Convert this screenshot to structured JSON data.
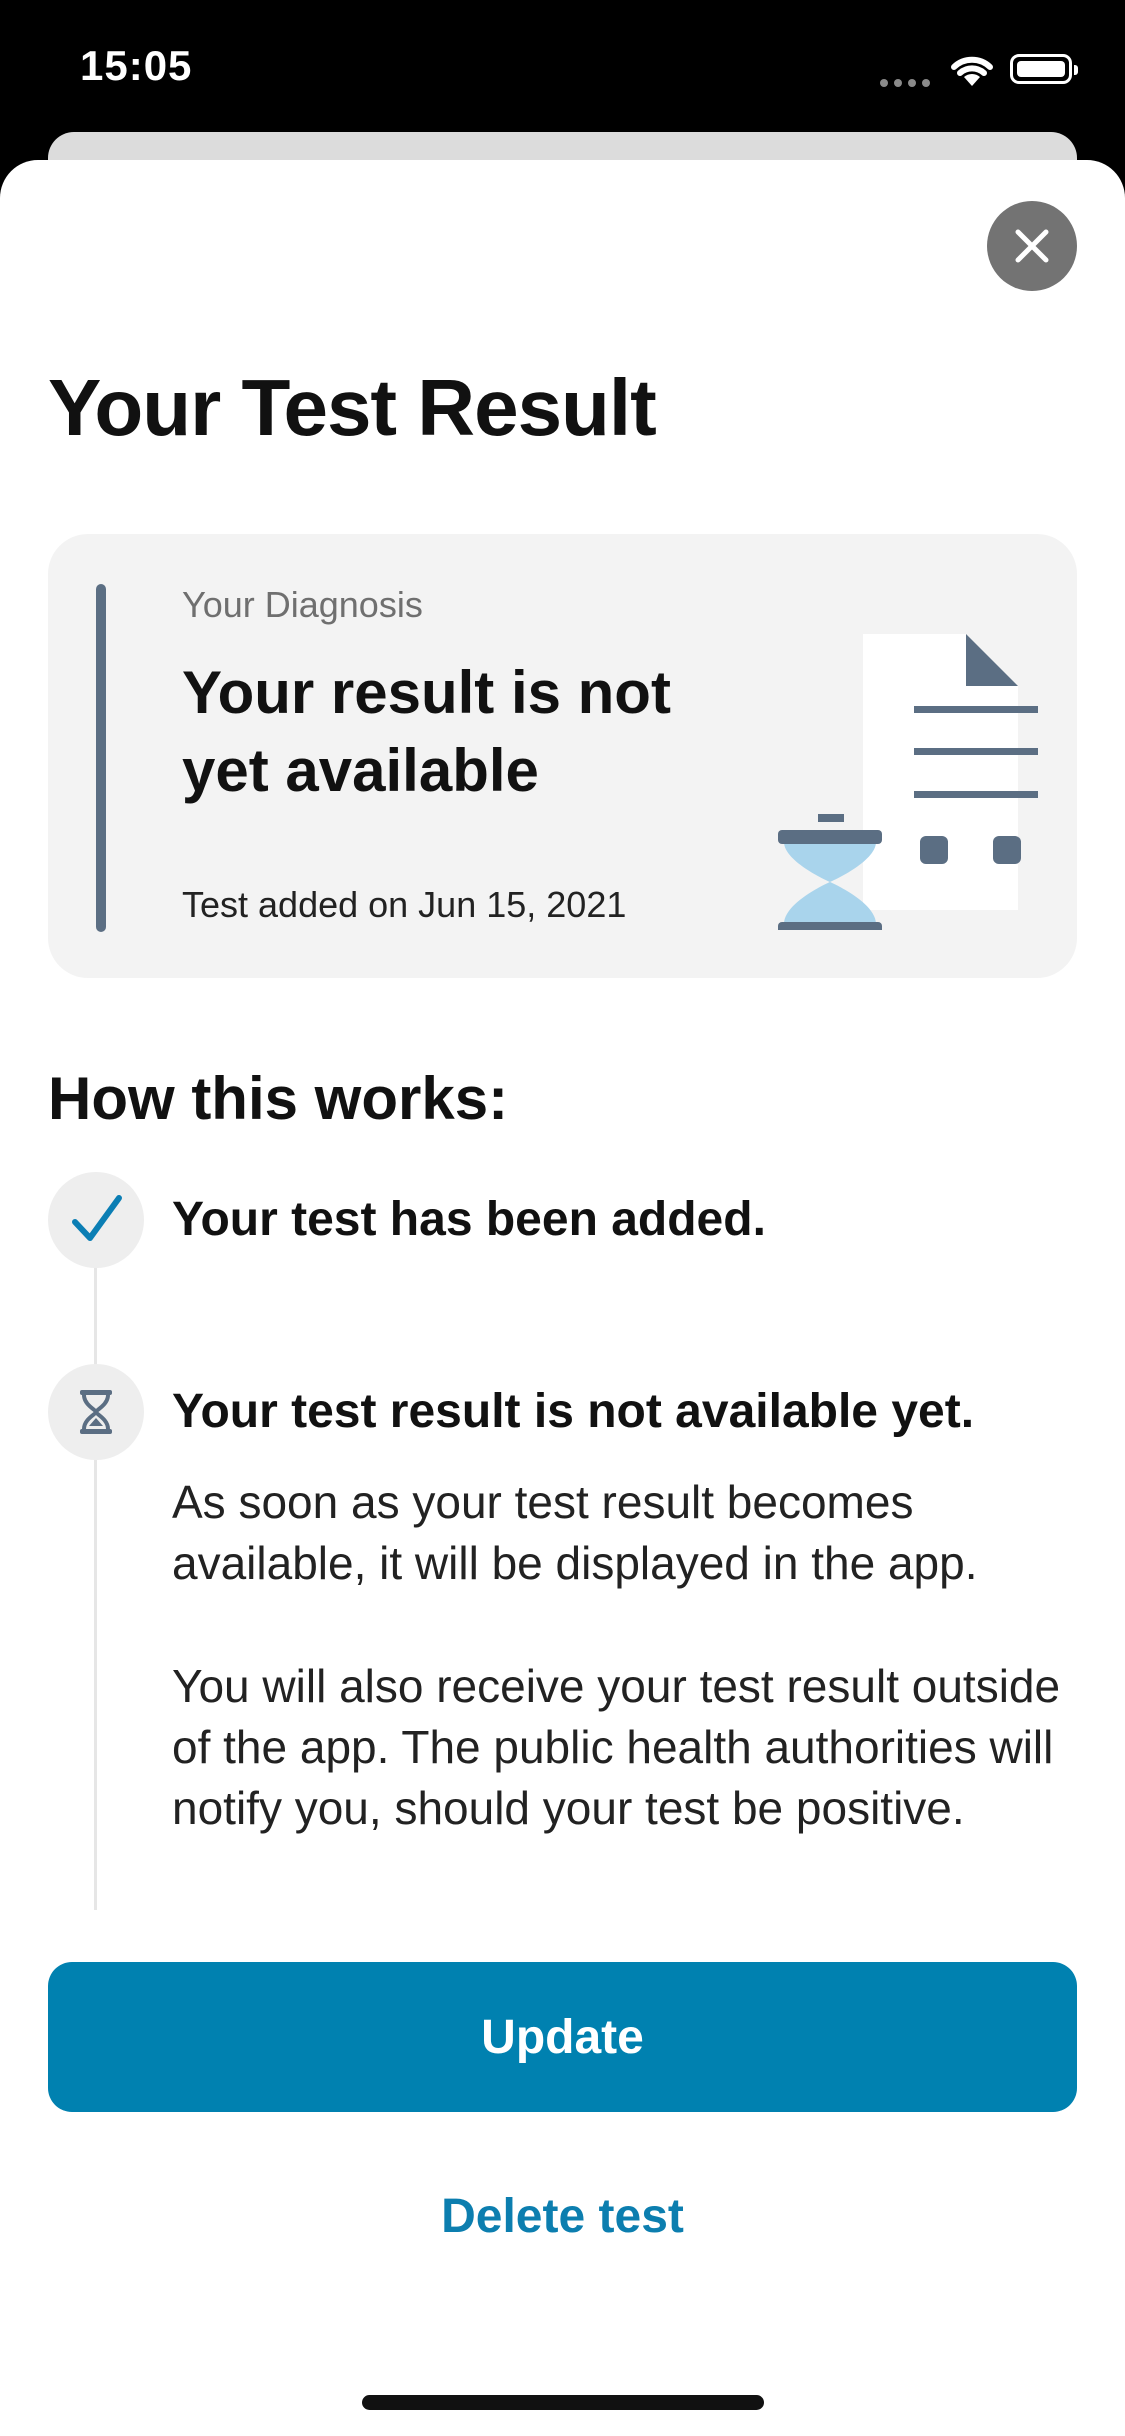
{
  "status_bar": {
    "time": "15:05"
  },
  "page": {
    "title": "Your Test Result"
  },
  "diagnosis_card": {
    "label": "Your Diagnosis",
    "headline": "Your result is not yet available",
    "date_text": "Test added on Jun 15, 2021",
    "illustration": "document-hourglass-icon"
  },
  "how_it_works": {
    "title": "How this works:",
    "steps": [
      {
        "icon": "checkmark-icon",
        "title": "Your test has been added.",
        "body": []
      },
      {
        "icon": "hourglass-icon",
        "title": "Your test result is not available yet.",
        "body": [
          "As soon as your test result becomes available, it will be displayed in the app.",
          "You will also receive your test result outside of the app. The public health authorities will notify you, should your test be positive."
        ]
      }
    ]
  },
  "actions": {
    "update_label": "Update",
    "delete_label": "Delete test"
  },
  "colors": {
    "accent": "#0081B0",
    "card_bar": "#5B6E83",
    "hourglass_sand": "#A9D4EC"
  }
}
